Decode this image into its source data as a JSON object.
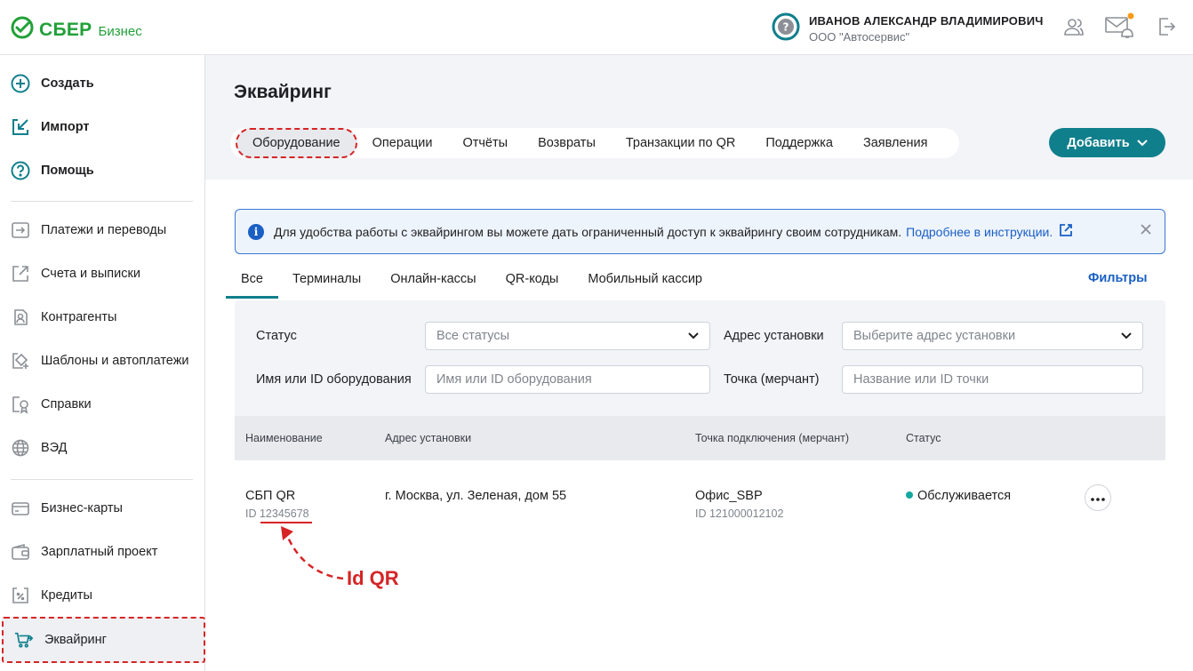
{
  "header": {
    "logo_text": "СБЕР",
    "logo_sub": "Бизнес",
    "user_name": "ИВАНОВ АЛЕКСАНДР ВЛАДИМИРОВИЧ",
    "user_org": "ООО \"Автосервис\"",
    "icons": [
      "help-circle-icon",
      "users-icon",
      "mail-bell-icon",
      "logout-icon"
    ],
    "notification_color": "#f59b1a"
  },
  "sidebar": {
    "primary": [
      {
        "label": "Создать",
        "icon": "plus-circle-icon"
      },
      {
        "label": "Импорт",
        "icon": "import-icon"
      },
      {
        "label": "Помощь",
        "icon": "question-circle-icon"
      }
    ],
    "group1": [
      {
        "label": "Платежи и переводы",
        "icon": "transfer-icon"
      },
      {
        "label": "Счета и выписки",
        "icon": "statement-icon"
      },
      {
        "label": "Контрагенты",
        "icon": "contractors-icon"
      },
      {
        "label": "Шаблоны и автоплатежи",
        "icon": "templates-icon"
      },
      {
        "label": "Справки",
        "icon": "certificates-icon"
      },
      {
        "label": "ВЭД",
        "icon": "globe-icon"
      }
    ],
    "group2": [
      {
        "label": "Бизнес-карты",
        "icon": "card-icon"
      },
      {
        "label": "Зарплатный проект",
        "icon": "wallet-icon"
      },
      {
        "label": "Кредиты",
        "icon": "percent-doc-icon"
      },
      {
        "label": "Эквайринг",
        "icon": "acquiring-cart-icon"
      }
    ]
  },
  "main": {
    "title": "Эквайринг",
    "tabs": [
      "Оборудование",
      "Операции",
      "Отчёты",
      "Возвраты",
      "Транзакции по QR",
      "Поддержка",
      "Заявления"
    ],
    "active_tab": "Оборудование",
    "add_button": "Добавить",
    "info": {
      "text": "Для удобства работы с эквайрингом вы можете дать ограниченный доступ к эквайрингу своим сотрудникам.",
      "link": "Подробнее в инструкции."
    },
    "subtabs": [
      "Все",
      "Терминалы",
      "Онлайн-кассы",
      "QR-коды",
      "Мобильный кассир"
    ],
    "active_subtab": "Все",
    "filters_link": "Фильтры",
    "filters": {
      "status_label": "Статус",
      "status_value": "Все статусы",
      "address_label": "Адрес установки",
      "address_placeholder": "Выберите адрес установки",
      "equipment_label": "Имя или ID оборудования",
      "equipment_placeholder": "Имя или ID оборудования",
      "merchant_label": "Точка (мерчант)",
      "merchant_placeholder": "Название или ID точки"
    },
    "table": {
      "columns": [
        "Наименование",
        "Адрес установки",
        "Точка подключения (мерчант)",
        "Статус"
      ],
      "rows": [
        {
          "name": "СБП QR",
          "id_prefix": "ID",
          "id": "12345678",
          "address": "г. Москва, ул. Зеленая, дом 55",
          "merchant": "Офис_SBP",
          "merchant_id": "ID 121000012102",
          "status": "Обслуживается"
        }
      ]
    },
    "annotation": "Id QR"
  },
  "colors": {
    "brand_green": "#21a038",
    "accent_teal": "#107f8c",
    "link_blue": "#1a5fc4",
    "annotation_red": "#d62426"
  }
}
